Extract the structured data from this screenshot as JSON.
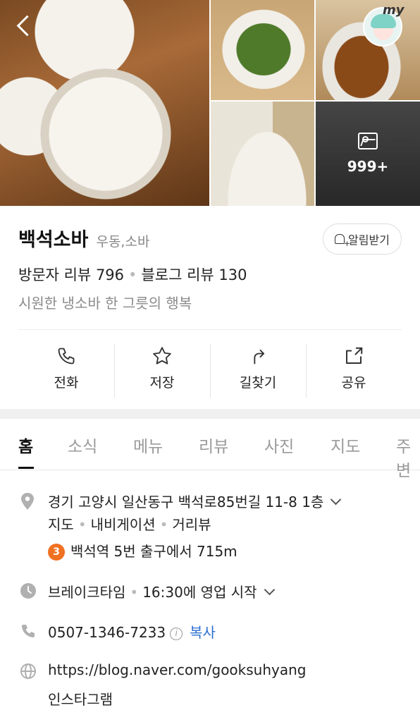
{
  "gallery": {
    "more_count": "999+",
    "profile_badge": "my"
  },
  "place": {
    "name": "백석소바",
    "category": "우동,소바",
    "alarm_label": "알림받기",
    "visitor_review": "방문자 리뷰 796",
    "blog_review": "블로그 리뷰 130",
    "description": "시원한 냉소바 한 그릇의 행복"
  },
  "actions": [
    {
      "label": "전화",
      "icon": "phone-icon"
    },
    {
      "label": "저장",
      "icon": "star-icon"
    },
    {
      "label": "길찾기",
      "icon": "directions-icon"
    },
    {
      "label": "공유",
      "icon": "share-icon"
    }
  ],
  "tabs": [
    "홈",
    "소식",
    "메뉴",
    "리뷰",
    "사진",
    "지도",
    "주변"
  ],
  "info": {
    "address": "경기 고양시 일산동구 백석로85번길 11-8 1층",
    "map_link": "지도",
    "navi_link": "내비게이션",
    "roadview_link": "거리뷰",
    "subway_line": "3",
    "subway_text": "백석역 5번 출구에서 715m",
    "hours": "브레이크타임",
    "hours_detail": "16:30에 영업 시작",
    "phone": "0507-1346-7233",
    "copy_label": "복사",
    "homepage": "https://blog.naver.com/gooksuhyang",
    "instagram": "인스타그램"
  },
  "colors": {
    "link": "#2c6fd1",
    "subway_line3": "#f07121"
  }
}
